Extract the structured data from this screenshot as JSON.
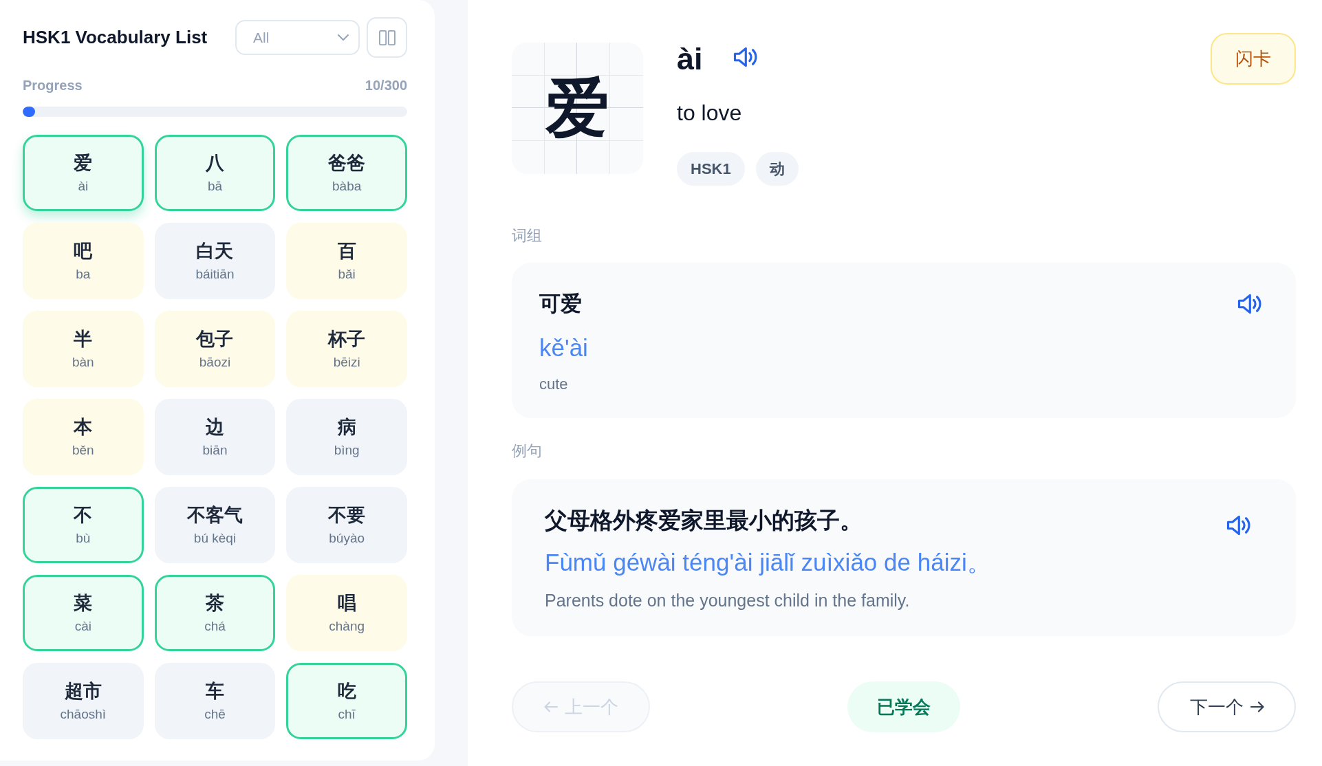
{
  "sidebar": {
    "title": "HSK1 Vocabulary List",
    "filter": {
      "value": "All"
    },
    "progress": {
      "label": "Progress",
      "count": "10/300",
      "level": 0.033
    },
    "words": [
      {
        "hanzi": "爱",
        "pinyin": "ài",
        "kind": "learned",
        "selected": true
      },
      {
        "hanzi": "八",
        "pinyin": "bā",
        "kind": "learned",
        "selected": false
      },
      {
        "hanzi": "爸爸",
        "pinyin": "bàba",
        "kind": "learned",
        "selected": false
      },
      {
        "hanzi": "吧",
        "pinyin": "ba",
        "kind": "learning",
        "selected": false
      },
      {
        "hanzi": "白天",
        "pinyin": "báitiān",
        "kind": "new",
        "selected": false
      },
      {
        "hanzi": "百",
        "pinyin": "bǎi",
        "kind": "learning",
        "selected": false
      },
      {
        "hanzi": "半",
        "pinyin": "bàn",
        "kind": "learning",
        "selected": false
      },
      {
        "hanzi": "包子",
        "pinyin": "bāozi",
        "kind": "learning",
        "selected": false
      },
      {
        "hanzi": "杯子",
        "pinyin": "bēizi",
        "kind": "learning",
        "selected": false
      },
      {
        "hanzi": "本",
        "pinyin": "běn",
        "kind": "learning",
        "selected": false
      },
      {
        "hanzi": "边",
        "pinyin": "biān",
        "kind": "new",
        "selected": false
      },
      {
        "hanzi": "病",
        "pinyin": "bìng",
        "kind": "new",
        "selected": false
      },
      {
        "hanzi": "不",
        "pinyin": "bù",
        "kind": "learned",
        "selected": false
      },
      {
        "hanzi": "不客气",
        "pinyin": "bú kèqi",
        "kind": "new",
        "selected": false
      },
      {
        "hanzi": "不要",
        "pinyin": "búyào",
        "kind": "new",
        "selected": false
      },
      {
        "hanzi": "菜",
        "pinyin": "cài",
        "kind": "learned",
        "selected": false
      },
      {
        "hanzi": "茶",
        "pinyin": "chá",
        "kind": "learned",
        "selected": false
      },
      {
        "hanzi": "唱",
        "pinyin": "chàng",
        "kind": "learning",
        "selected": false
      },
      {
        "hanzi": "超市",
        "pinyin": "chāoshì",
        "kind": "new",
        "selected": false
      },
      {
        "hanzi": "车",
        "pinyin": "chē",
        "kind": "new",
        "selected": false
      },
      {
        "hanzi": "吃",
        "pinyin": "chī",
        "kind": "learned",
        "selected": false
      }
    ]
  },
  "detail": {
    "hanzi": "爱",
    "pinyin": "ài",
    "meaning": "to love",
    "tags": [
      "HSK1",
      "动"
    ],
    "flashcard_button": "闪卡",
    "phrases_heading": "词组",
    "phrase": {
      "hanzi": "可爱",
      "pinyin": "kě'ài",
      "meaning": "cute"
    },
    "examples_heading": "例句",
    "example": {
      "sentence": "父母格外疼爱家里最小的孩子。",
      "pinyin": "Fùmǔ géwài téng'ài jiālǐ zuìxiǎo de háizi。",
      "translation": "Parents dote on the youngest child in the family."
    }
  },
  "footer": {
    "previous": {
      "label": "上一个",
      "disabled": true
    },
    "learned": {
      "label": "已学会"
    },
    "next": {
      "label": "下一个",
      "disabled": false
    }
  }
}
